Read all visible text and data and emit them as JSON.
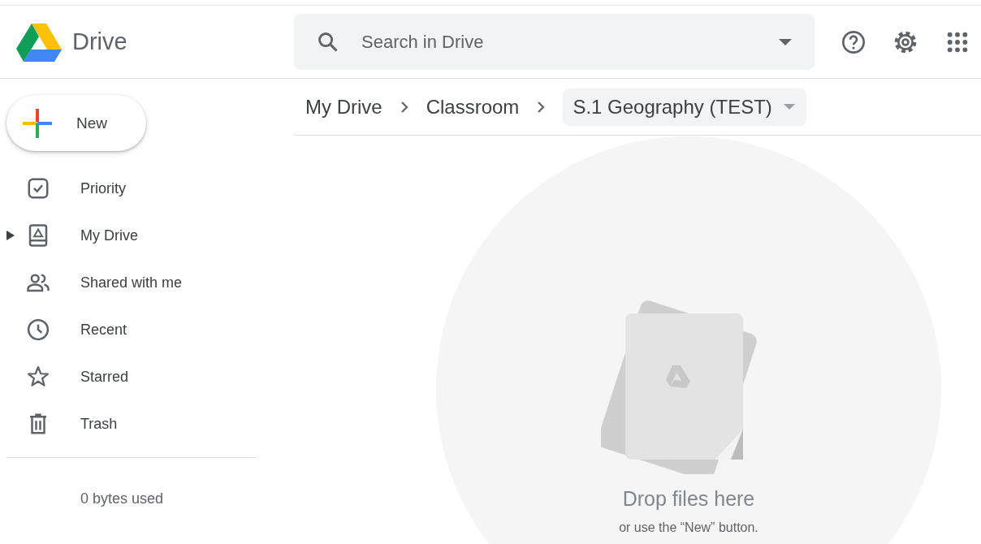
{
  "header": {
    "app_name": "Drive",
    "search": {
      "placeholder": "Search in Drive"
    }
  },
  "new_button": {
    "label": "New"
  },
  "sidebar": {
    "items": [
      {
        "label": "Priority",
        "kind": "priority",
        "selected": false
      },
      {
        "label": "My Drive",
        "kind": "my-drive",
        "selected": false,
        "expanded": false
      },
      {
        "label": "Shared with me",
        "kind": "shared",
        "selected": false
      },
      {
        "label": "Recent",
        "kind": "recent",
        "selected": false
      },
      {
        "label": "Starred",
        "kind": "starred",
        "selected": false
      },
      {
        "label": "Trash",
        "kind": "trash",
        "selected": false
      }
    ],
    "storage": "0 bytes used"
  },
  "breadcrumbs": [
    {
      "label": "My Drive",
      "kind": "link"
    },
    {
      "label": "Classroom",
      "kind": "link"
    },
    {
      "label": "S.1 Geography (TEST)",
      "kind": "current"
    }
  ],
  "empty_state": {
    "title": "Drop files here",
    "hint": "or use the “New” button."
  }
}
